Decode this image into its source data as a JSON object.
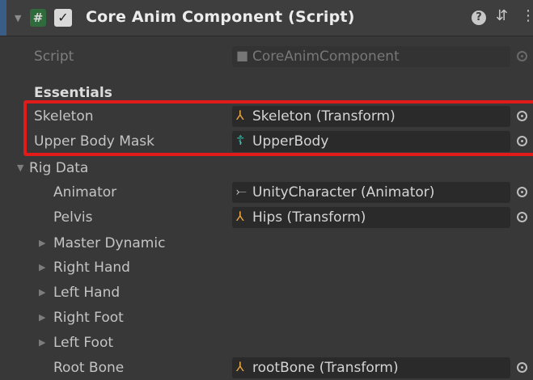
{
  "header": {
    "title": "Core Anim Component (Script)",
    "script_icon": "#",
    "checkbox": "✓",
    "help_icon": "?",
    "settings_icon": "⇵",
    "menu_icon": "⋮"
  },
  "script_field": {
    "label": "Script",
    "value": "CoreAnimComponent"
  },
  "essentials": {
    "title": "Essentials",
    "skeleton": {
      "label": "Skeleton",
      "value": "Skeleton (Transform)"
    },
    "upper_body_mask": {
      "label": "Upper Body Mask",
      "value": "UpperBody"
    }
  },
  "rig_data": {
    "title": "Rig Data",
    "animator": {
      "label": "Animator",
      "value": "UnityCharacter (Animator)"
    },
    "pelvis": {
      "label": "Pelvis",
      "value": "Hips (Transform)"
    },
    "foldouts": [
      "Master Dynamic",
      "Right Hand",
      "Left Hand",
      "Right Foot",
      "Left Foot"
    ],
    "root_bone": {
      "label": "Root Bone",
      "value": "rootBone (Transform)"
    }
  },
  "colors": {
    "highlight": "#e21a1a",
    "transform_icon": "#e8a33a",
    "avatar_mask_icon": "#38c7b4"
  }
}
